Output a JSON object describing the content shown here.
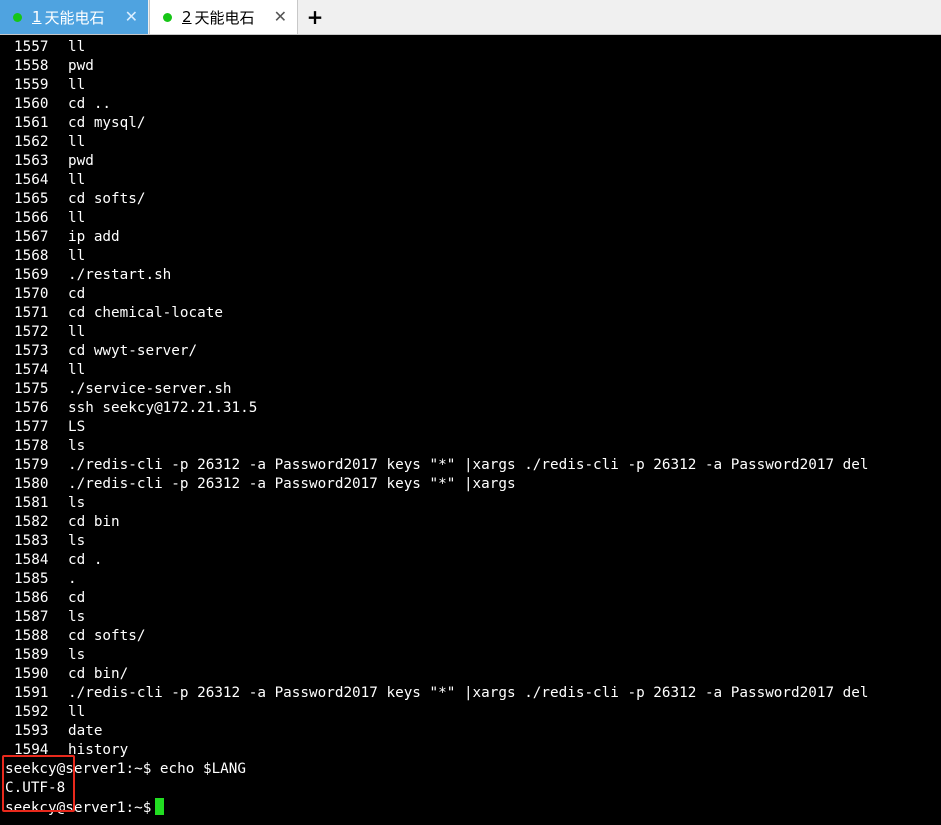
{
  "tabs": [
    {
      "number": "1",
      "title": "天能电石",
      "close": "✕",
      "active": true
    },
    {
      "number": "2",
      "title": "天能电石",
      "close": "✕",
      "active": false
    }
  ],
  "new_tab_label": "+",
  "history": [
    {
      "n": "1557",
      "cmd": "ll"
    },
    {
      "n": "1558",
      "cmd": "pwd"
    },
    {
      "n": "1559",
      "cmd": "ll"
    },
    {
      "n": "1560",
      "cmd": "cd .."
    },
    {
      "n": "1561",
      "cmd": "cd mysql/"
    },
    {
      "n": "1562",
      "cmd": "ll"
    },
    {
      "n": "1563",
      "cmd": "pwd"
    },
    {
      "n": "1564",
      "cmd": "ll"
    },
    {
      "n": "1565",
      "cmd": "cd softs/"
    },
    {
      "n": "1566",
      "cmd": "ll"
    },
    {
      "n": "1567",
      "cmd": "ip add"
    },
    {
      "n": "1568",
      "cmd": "ll"
    },
    {
      "n": "1569",
      "cmd": "./restart.sh"
    },
    {
      "n": "1570",
      "cmd": "cd"
    },
    {
      "n": "1571",
      "cmd": "cd chemical-locate"
    },
    {
      "n": "1572",
      "cmd": "ll"
    },
    {
      "n": "1573",
      "cmd": "cd wwyt-server/"
    },
    {
      "n": "1574",
      "cmd": "ll"
    },
    {
      "n": "1575",
      "cmd": "./service-server.sh"
    },
    {
      "n": "1576",
      "cmd": "ssh seekcy@172.21.31.5"
    },
    {
      "n": "1577",
      "cmd": "LS"
    },
    {
      "n": "1578",
      "cmd": "ls"
    },
    {
      "n": "1579",
      "cmd": "./redis-cli -p 26312 -a Password2017 keys \"*\" |xargs ./redis-cli -p 26312 -a Password2017 del"
    },
    {
      "n": "1580",
      "cmd": "./redis-cli -p 26312 -a Password2017 keys \"*\" |xargs"
    },
    {
      "n": "1581",
      "cmd": "ls"
    },
    {
      "n": "1582",
      "cmd": "cd bin"
    },
    {
      "n": "1583",
      "cmd": "ls"
    },
    {
      "n": "1584",
      "cmd": "cd ."
    },
    {
      "n": "1585",
      "cmd": "."
    },
    {
      "n": "1586",
      "cmd": "cd"
    },
    {
      "n": "1587",
      "cmd": "ls"
    },
    {
      "n": "1588",
      "cmd": "cd softs/"
    },
    {
      "n": "1589",
      "cmd": "ls"
    },
    {
      "n": "1590",
      "cmd": "cd bin/"
    },
    {
      "n": "1591",
      "cmd": "./redis-cli -p 26312 -a Password2017 keys \"*\" |xargs ./redis-cli -p 26312 -a Password2017 del"
    },
    {
      "n": "1592",
      "cmd": "ll"
    },
    {
      "n": "1593",
      "cmd": "date"
    },
    {
      "n": "1594",
      "cmd": "history"
    }
  ],
  "prompt_lines": [
    {
      "text": "seekcy@server1:~$ echo $LANG",
      "cursor": false
    },
    {
      "text": "C.UTF-8",
      "cursor": false
    },
    {
      "text": "seekcy@server1:~$",
      "cursor": true
    }
  ],
  "colors": {
    "active_tab": "#4fa3e0",
    "status_dot": "#17c617",
    "cursor": "#22dd22",
    "highlight": "#e8291c"
  }
}
